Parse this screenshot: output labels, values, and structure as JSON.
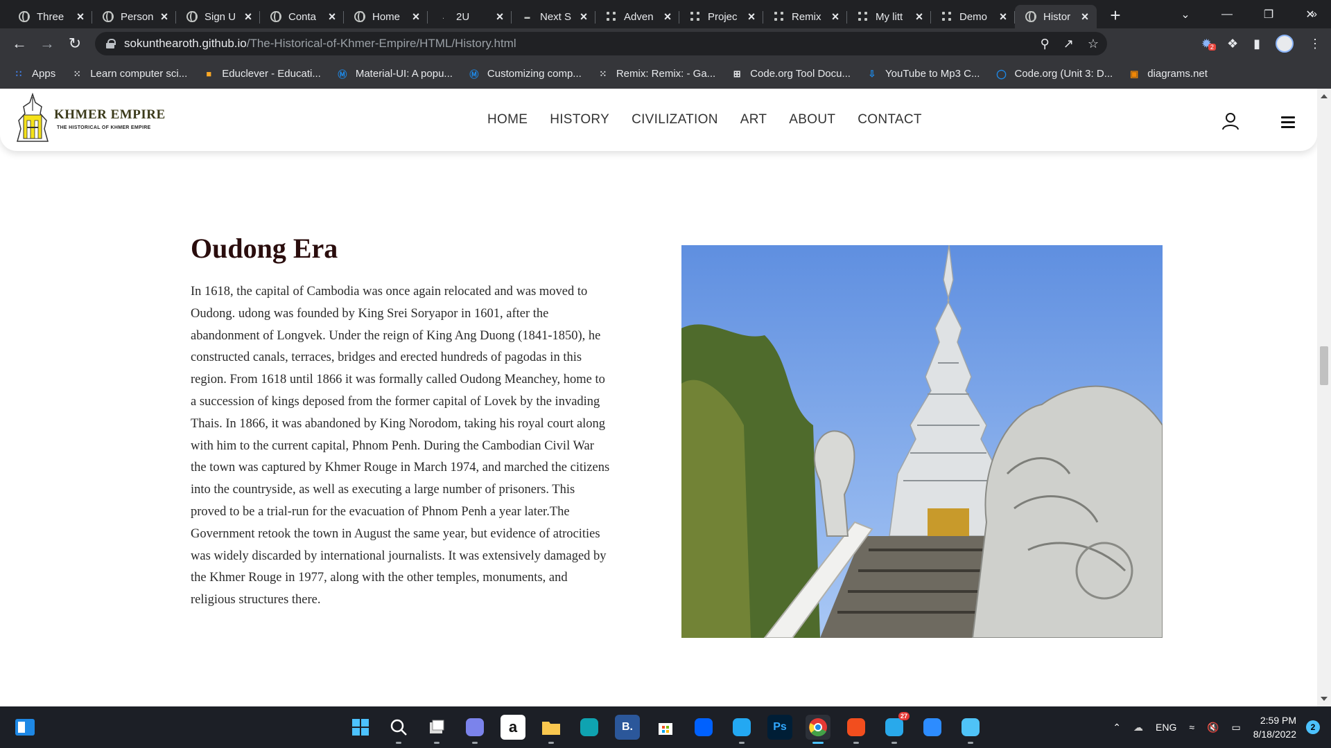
{
  "browser": {
    "tabs": [
      {
        "title": "Three",
        "icon": "globe-icon"
      },
      {
        "title": "Person",
        "icon": "globe-icon"
      },
      {
        "title": "Sign U",
        "icon": "globe-icon"
      },
      {
        "title": "Conta",
        "icon": "globe-icon"
      },
      {
        "title": "Home",
        "icon": "globe-icon"
      },
      {
        "title": "2U",
        "icon": "dot-icon"
      },
      {
        "title": "Next S",
        "icon": "next-icon"
      },
      {
        "title": "Adven",
        "icon": "dots-icon"
      },
      {
        "title": "Projec",
        "icon": "dots-icon"
      },
      {
        "title": "Remix",
        "icon": "dots-icon"
      },
      {
        "title": "My litt",
        "icon": "dots-icon"
      },
      {
        "title": "Demo",
        "icon": "dots-icon"
      },
      {
        "title": "Histor",
        "icon": "globe-icon",
        "active": true
      }
    ],
    "url_host": "sokunthearoth.github.io",
    "url_path": "/The-Historical-of-Khmer-Empire/HTML/History.html",
    "extension_badge": "2",
    "bookmarks": [
      {
        "label": "Apps",
        "icon": "apps-grid-icon",
        "color": "#4285f4"
      },
      {
        "label": "Learn computer sci...",
        "icon": "code-org-icon",
        "color": "#e8eaed"
      },
      {
        "label": "Educlever - Educati...",
        "icon": "book-icon",
        "color": "#f9a825"
      },
      {
        "label": "Material-UI: A popu...",
        "icon": "mui-icon",
        "color": "#1e88e5"
      },
      {
        "label": "Customizing comp...",
        "icon": "mui-icon",
        "color": "#1e88e5"
      },
      {
        "label": "Remix: Remix: - Ga...",
        "icon": "code-org-icon",
        "color": "#e8eaed"
      },
      {
        "label": "Code.org Tool Docu...",
        "icon": "grid-icon",
        "color": "#e8eaed"
      },
      {
        "label": "YouTube to Mp3 C...",
        "icon": "download-icon",
        "color": "#1e88e5"
      },
      {
        "label": "Code.org (Unit 3: D...",
        "icon": "search-circle-icon",
        "color": "#1e88e5"
      },
      {
        "label": "diagrams.net",
        "icon": "diagrams-icon",
        "color": "#f08705"
      }
    ]
  },
  "site": {
    "logo_title": "KHMER EMPIRE",
    "logo_subtitle": "THE HISTORICAL OF KHMER EMPIRE",
    "nav": [
      "HOME",
      "HISTORY",
      "CIVILIZATION",
      "ART",
      "ABOUT",
      "CONTACT"
    ]
  },
  "article": {
    "title": "Oudong Era",
    "body": "In 1618, the capital of Cambodia was once again relocated and was moved to Oudong. udong was founded by King Srei Soryapor in 1601, after the abandonment of Longvek. Under the reign of King Ang Duong (1841-1850), he constructed canals, terraces, bridges and erected hundreds of pagodas in this region. From 1618 until 1866 it was formally called Oudong Meanchey, home to a succession of kings deposed from the former capital of Lovek by the invading Thais. In 1866, it was abandoned by King Norodom, taking his royal court along with him to the current capital, Phnom Penh. During the Cambodian Civil War the town was captured by Khmer Rouge in March 1974, and marched the citizens into the countryside, as well as executing a large number of prisoners. This proved to be a trial-run for the evacuation of Phnom Penh a year later.The Government retook the town in August the same year, but evidence of atrocities was widely discarded by international journalists. It was extensively damaged by the Khmer Rouge in 1977, along with the other temples, monuments, and religious structures there."
  },
  "taskbar": {
    "apps": [
      {
        "name": "start-icon",
        "glyph": "",
        "color": "#4cc2ff"
      },
      {
        "name": "search-icon",
        "glyph": "",
        "color": "#fff"
      },
      {
        "name": "task-view-icon",
        "glyph": "",
        "color": "#fff"
      },
      {
        "name": "teams-icon",
        "glyph": "",
        "color": "#7b83eb"
      },
      {
        "name": "amazon-icon",
        "glyph": "a",
        "color": "#fff"
      },
      {
        "name": "file-explorer-icon",
        "glyph": "",
        "color": "#f9c74f"
      },
      {
        "name": "edge-icon",
        "glyph": "",
        "color": "#0fa3b1"
      },
      {
        "name": "bootstrap-icon",
        "glyph": "B.",
        "color": "#2b579a"
      },
      {
        "name": "store-icon",
        "glyph": "",
        "color": "#fff"
      },
      {
        "name": "dropbox-icon",
        "glyph": "",
        "color": "#0061fe"
      },
      {
        "name": "vscode-icon",
        "glyph": "",
        "color": "#23a8f2"
      },
      {
        "name": "photoshop-icon",
        "glyph": "Ps",
        "color": "#31a8ff"
      },
      {
        "name": "chrome-icon",
        "glyph": "",
        "color": "#e53935"
      },
      {
        "name": "figma-icon",
        "glyph": "",
        "color": "#f24e1e"
      },
      {
        "name": "telegram-icon",
        "glyph": "",
        "color": "#29a9eb"
      },
      {
        "name": "zoom-icon",
        "glyph": "",
        "color": "#2d8cff"
      },
      {
        "name": "notepad-icon",
        "glyph": "",
        "color": "#4fc3f7"
      }
    ],
    "telegram_badge": "27",
    "language": "ENG",
    "time": "2:59 PM",
    "date": "8/18/2022",
    "notifications": "2"
  }
}
